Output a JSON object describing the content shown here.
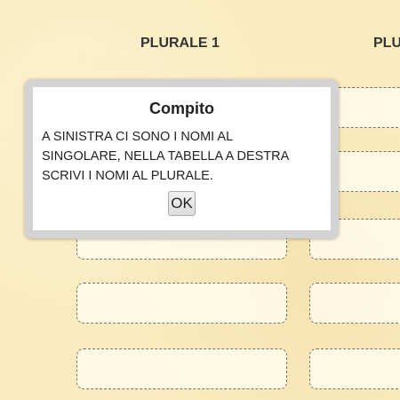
{
  "table": {
    "headers": [
      "PLURALE 1",
      "PLU"
    ],
    "rows": 5
  },
  "dialog": {
    "title": "Compito",
    "text": "A SINISTRA CI SONO I NOMI AL\nSINGOLARE, NELLA TABELLA A DESTRA\nSCRIVI I NOMI AL PLURALE.",
    "ok_label": "OK"
  }
}
